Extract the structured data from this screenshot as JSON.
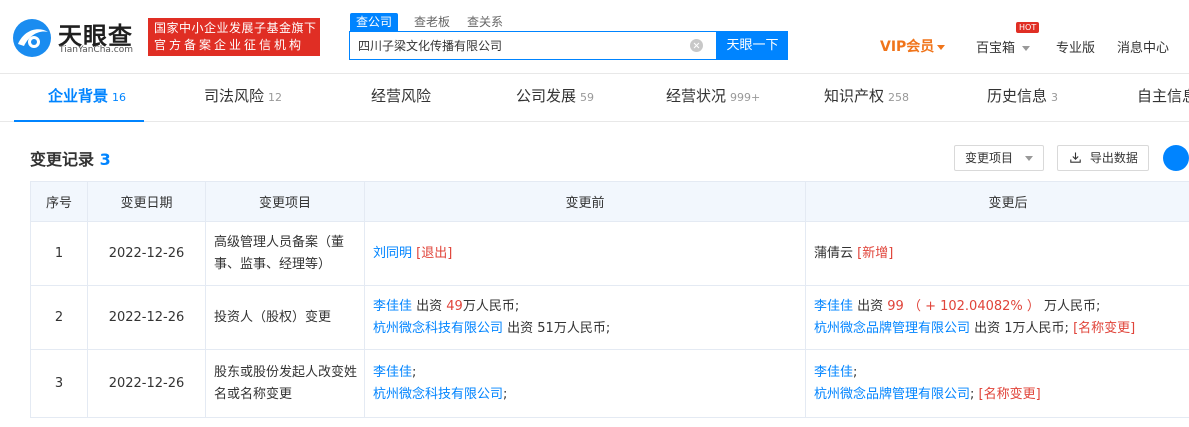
{
  "header": {
    "logo_name": "天眼查",
    "logo_url": "TianYanCha.com",
    "badge_line1": "国家中小企业发展子基金旗下",
    "badge_line2": "官方备案企业征信机构",
    "search_tabs": [
      "查公司",
      "查老板",
      "查关系"
    ],
    "search_value": "四川子梁文化传播有限公司",
    "search_button": "天眼一下",
    "vip_label": "VIP会员",
    "hot_badge": "HOT",
    "baibaoxiang": "百宝箱",
    "pro_edition": "专业版",
    "message_center": "消息中心"
  },
  "tabs": [
    {
      "label": "企业背景",
      "count": "16"
    },
    {
      "label": "司法风险",
      "count": "12"
    },
    {
      "label": "经营风险",
      "count": ""
    },
    {
      "label": "公司发展",
      "count": "59"
    },
    {
      "label": "经营状况",
      "count": "999+"
    },
    {
      "label": "知识产权",
      "count": "258"
    },
    {
      "label": "历史信息",
      "count": "3"
    },
    {
      "label": "自主信息",
      "count": ""
    }
  ],
  "section": {
    "title": "变更记录",
    "count": "3",
    "filter_label": "变更项目",
    "export_label": "导出数据"
  },
  "table": {
    "headers": [
      "序号",
      "变更日期",
      "变更项目",
      "变更前",
      "变更后"
    ],
    "rows": [
      {
        "index": "1",
        "date": "2022-12-26",
        "item": "高级管理人员备案（董事、监事、经理等）",
        "before": [
          {
            "name": "刘同明",
            "text": "",
            "tag": "[退出]"
          }
        ],
        "after": [
          {
            "name": "",
            "text": "蒲倩云",
            "tag": "[新增]"
          }
        ]
      },
      {
        "index": "2",
        "date": "2022-12-26",
        "item": "投资人（股权）变更",
        "before": [
          {
            "name": "李佳佳",
            "text_pre": " 出资 ",
            "amount": "49",
            "text_post": "万人民币;"
          },
          {
            "name": "杭州微念科技有限公司",
            "text_pre": " 出资 51万人民币;",
            "amount": "",
            "text_post": ""
          }
        ],
        "after": [
          {
            "name": "李佳佳",
            "text_pre": " 出资 ",
            "amount": "99 （ + 102.04082% ）",
            "text_post": " 万人民币;"
          },
          {
            "name": "杭州微念品牌管理有限公司",
            "text_pre": " 出资 1万人民币;",
            "amount": "",
            "text_post": "",
            "tag": " [名称变更]"
          }
        ]
      },
      {
        "index": "3",
        "date": "2022-12-26",
        "item": "股东或股份发起人改变姓名或名称变更",
        "before": [
          {
            "name": "李佳佳",
            "suffix": ";"
          },
          {
            "name": "杭州微念科技有限公司",
            "suffix": ";"
          }
        ],
        "after": [
          {
            "name": "李佳佳",
            "suffix": ";"
          },
          {
            "name": "杭州微念品牌管理有限公司",
            "suffix": ";",
            "tag": " [名称变更]"
          }
        ]
      }
    ]
  },
  "colors": {
    "accent": "#0084ff",
    "danger": "#e0443a",
    "brand_red": "#e02e24",
    "vip": "#f0741a"
  }
}
